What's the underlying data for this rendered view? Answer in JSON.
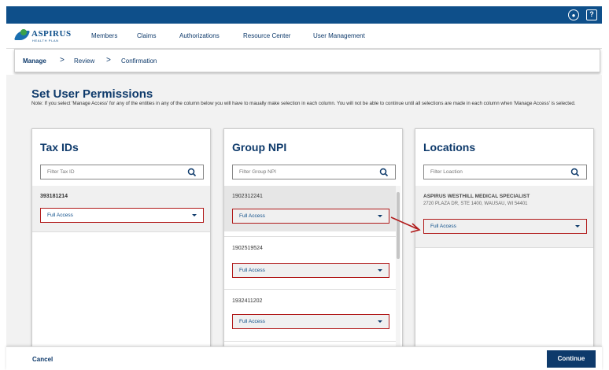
{
  "header": {
    "user_icon": "user-circle-icon",
    "help_icon": "help-icon",
    "accent_color": "#0e4f8a",
    "brand_color": "#0e3a6b",
    "highlight_color": "#b11a1a"
  },
  "logo": {
    "name": "ASPIRUS",
    "sub": "HEALTH PLAN"
  },
  "nav": {
    "members": "Members",
    "claims": "Claims",
    "authorizations": "Authorizations",
    "resource_center": "Resource Center",
    "user_management": "User Management"
  },
  "breadcrumb": {
    "manage": "Manage",
    "review": "Review",
    "confirmation": "Confirmation",
    "separator": ">"
  },
  "page": {
    "title": "Set User Permissions",
    "note": "Note: If you select 'Manage Access' for any of the entities in any of the column below you will have to maually make selection in each column. You will not be able to continue until all selections are made in each column when 'Manage Access' is selected."
  },
  "tax_ids": {
    "title": "Tax IDs",
    "filter_placeholder": "Filter Tax ID",
    "items": [
      {
        "code": "393181214",
        "access": "Full Access"
      }
    ]
  },
  "group_npi": {
    "title": "Group NPI",
    "filter_placeholder": "Filter Group NPI",
    "items": [
      {
        "code": "1902312241",
        "access": "Full Access"
      },
      {
        "code": "1902519524",
        "access": "Full Access"
      },
      {
        "code": "1932411202",
        "access": "Full Access"
      }
    ]
  },
  "locations": {
    "title": "Locations",
    "filter_placeholder": "Filter Loaction",
    "items": [
      {
        "name": "ASPIRUS WESTHILL MEDICAL SPECIALIST",
        "address": "2720 PLAZA DR, STE 1400, WAUSAU, WI 54401",
        "access": "Full Access"
      }
    ]
  },
  "footer": {
    "cancel": "Cancel",
    "continue": "Continue"
  }
}
